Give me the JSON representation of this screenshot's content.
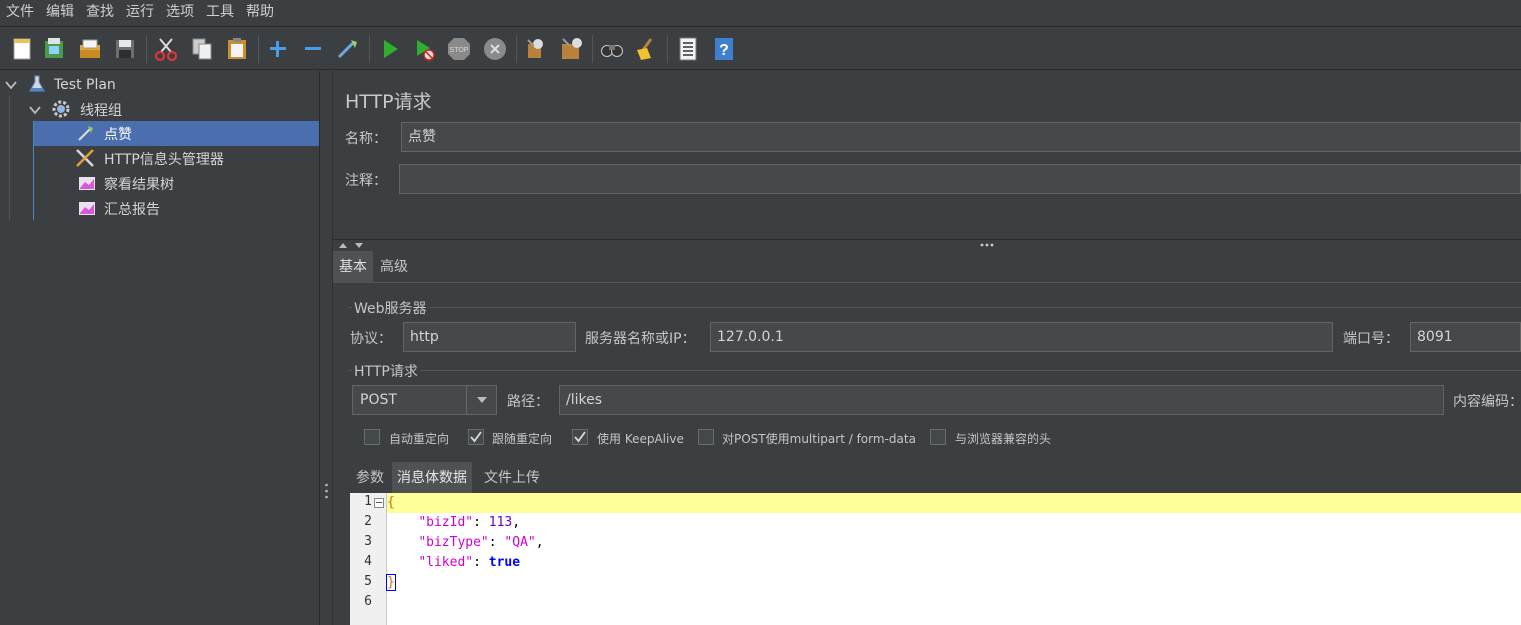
{
  "menu": [
    "文件",
    "编辑",
    "查找",
    "运行",
    "选项",
    "工具",
    "帮助"
  ],
  "toolbar_icons": [
    "new-icon",
    "templates-icon",
    "open-icon",
    "save-icon",
    "cut-icon",
    "copy-icon",
    "paste-icon",
    "expand-icon",
    "collapse-icon",
    "toggle-icon",
    "start-icon",
    "start-no-timers-icon",
    "stop-icon",
    "shutdown-icon",
    "clear-icon",
    "clear-all-icon",
    "search-icon",
    "reset-search-icon",
    "function-helper-icon",
    "help-icon"
  ],
  "tree": {
    "items": [
      {
        "label": "Test Plan",
        "icon": "test-plan-icon"
      },
      {
        "label": "线程组",
        "icon": "gear-icon"
      },
      {
        "label": "点赞",
        "icon": "http-sampler-icon",
        "selected": true
      },
      {
        "label": "HTTP信息头管理器",
        "icon": "tools-icon"
      },
      {
        "label": "察看结果树",
        "icon": "listener-icon"
      },
      {
        "label": "汇总报告",
        "icon": "listener-icon"
      }
    ]
  },
  "panel": {
    "title": "HTTP请求",
    "name_label": "名称：",
    "name_value": "点赞",
    "comment_label": "注释：",
    "comment_value": "",
    "tabs": [
      "基本",
      "高级"
    ],
    "web_server": {
      "title": "Web服务器",
      "protocol_label": "协议：",
      "protocol_value": "http",
      "server_label": "服务器名称或IP：",
      "server_value": "127.0.0.1",
      "port_label": "端口号：",
      "port_value": "8091"
    },
    "http_request": {
      "title": "HTTP请求",
      "method": "POST",
      "path_label": "路径：",
      "path_value": "/likes",
      "encoding_label": "内容编码："
    },
    "checkboxes": [
      {
        "label": "自动重定向",
        "checked": false
      },
      {
        "label": "跟随重定向",
        "checked": true
      },
      {
        "label": "使用 KeepAlive",
        "checked": true
      },
      {
        "label": "对POST使用multipart / form-data",
        "checked": false
      },
      {
        "label": "与浏览器兼容的头",
        "checked": false
      }
    ],
    "subtabs": [
      "参数",
      "消息体数据",
      "文件上传"
    ],
    "body": {
      "line_numbers": [
        "1",
        "2",
        "3",
        "4",
        "5",
        "6"
      ],
      "lines": [
        {
          "brace": "{"
        },
        {
          "key": "\"bizId\"",
          "sep": ": ",
          "value": "113",
          "end": ","
        },
        {
          "key": "\"bizType\"",
          "sep": ": ",
          "value": "\"QA\"",
          "end": ","
        },
        {
          "key": "\"liked\"",
          "sep": ": ",
          "value": "true",
          "end": ""
        },
        {
          "brace": "}"
        },
        {}
      ]
    }
  }
}
